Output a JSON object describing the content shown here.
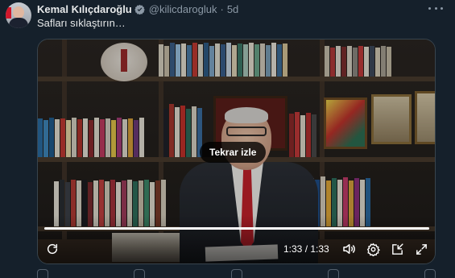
{
  "tweet": {
    "author_name": "Kemal Kılıçdaroğlu",
    "handle": "@kilicdarogluk",
    "separator": "·",
    "time_ago": "5d",
    "text": "Safları sıklaştırın…"
  },
  "video": {
    "replay_prompt": "Tekrar izle",
    "time_display": "1:33 / 1:33",
    "progress_fraction": 1.0
  },
  "colors": {
    "background": "#15202b",
    "text_primary": "#e7e9ea",
    "text_secondary": "#8b98a5",
    "verified_badge": "#8b98a5",
    "border": "#38444d"
  },
  "icons": {
    "verified": "verified-badge-icon",
    "more": "more-icon",
    "replay": "replay-icon",
    "volume": "volume-icon",
    "settings": "settings-icon",
    "dock": "dock-icon",
    "fullscreen": "fullscreen-icon"
  }
}
